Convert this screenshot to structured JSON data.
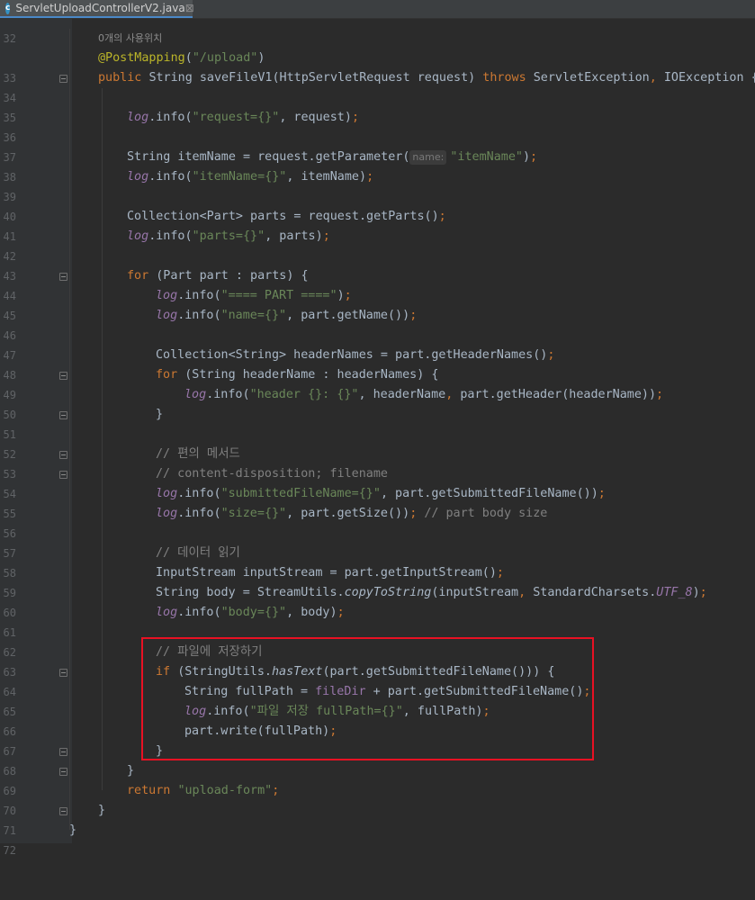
{
  "tab": {
    "icon": "c",
    "title": "ServletUploadControllerV2.java",
    "close": "⊠"
  },
  "usage_hint": "0개의 사용위치",
  "param_hint": "name:",
  "lines": {
    "n32": "32",
    "n33": "33",
    "n34": "34",
    "n35": "35",
    "n36": "36",
    "n37": "37",
    "n38": "38",
    "n39": "39",
    "n40": "40",
    "n41": "41",
    "n42": "42",
    "n43": "43",
    "n44": "44",
    "n45": "45",
    "n46": "46",
    "n47": "47",
    "n48": "48",
    "n49": "49",
    "n50": "50",
    "n51": "51",
    "n52": "52",
    "n53": "53",
    "n54": "54",
    "n55": "55",
    "n56": "56",
    "n57": "57",
    "n58": "58",
    "n59": "59",
    "n60": "60",
    "n61": "61",
    "n62": "62",
    "n63": "63",
    "n64": "64",
    "n65": "65",
    "n66": "66",
    "n67": "67",
    "n68": "68",
    "n69": "69",
    "n70": "70",
    "n71": "71",
    "n72": "72"
  },
  "code": {
    "l33": [
      "@PostMapping",
      "(",
      "\"/upload\"",
      ")"
    ],
    "l34": [
      "public ",
      "String saveFileV1(HttpServletRequest request) ",
      "throws ",
      "ServletException",
      ", ",
      "IOException {"
    ],
    "l36": [
      "log",
      ".info(",
      "\"request={}\"",
      ", request)",
      ";"
    ],
    "l38": [
      "String itemName = request.getParameter(",
      "\"itemName\"",
      ")",
      ";"
    ],
    "l39": [
      "log",
      ".info(",
      "\"itemName={}\"",
      ", itemName)",
      ";"
    ],
    "l41": [
      "Collection<Part> parts = request.getParts()",
      ";"
    ],
    "l42": [
      "log",
      ".info(",
      "\"parts={}\"",
      ", parts)",
      ";"
    ],
    "l44": [
      "for ",
      "(Part part : parts) {"
    ],
    "l45": [
      "log",
      ".info(",
      "\"==== PART ====\"",
      ")",
      ";"
    ],
    "l46": [
      "log",
      ".info(",
      "\"name={}\"",
      ", part.getName())",
      ";"
    ],
    "l48": [
      "Collection<String> headerNames = part.getHeaderNames()",
      ";"
    ],
    "l49": [
      "for ",
      "(String headerName : headerNames) {"
    ],
    "l50": [
      "log",
      ".info(",
      "\"header {}: {}\"",
      ", headerName",
      ", ",
      "part.getHeader(headerName))",
      ";"
    ],
    "l51": [
      "}"
    ],
    "l53": [
      "// 편의 메서드"
    ],
    "l54": [
      "// content-disposition; filename"
    ],
    "l55": [
      "log",
      ".info(",
      "\"submittedFileName={}\"",
      ", part.getSubmittedFileName())",
      ";"
    ],
    "l56": [
      "log",
      ".info(",
      "\"size={}\"",
      ", part.getSize())",
      "; ",
      "// part body size"
    ],
    "l58": [
      "// 데이터 읽기"
    ],
    "l59": [
      "InputStream inputStream = part.getInputStream()",
      ";"
    ],
    "l60": [
      "String body = StreamUtils.",
      "copyToString",
      "(inputStream",
      ", ",
      "StandardCharsets.",
      "UTF_8",
      ")",
      ";"
    ],
    "l61": [
      "log",
      ".info(",
      "\"body={}\"",
      ", body)",
      ";"
    ],
    "l63": [
      "// 파일에 저장하기"
    ],
    "l64": [
      "if ",
      "(StringUtils.",
      "hasText",
      "(part.getSubmittedFileName())) {"
    ],
    "l65": [
      "String fullPath = ",
      "fileDir ",
      "+ part.getSubmittedFileName()",
      ";"
    ],
    "l66": [
      "log",
      ".info(",
      "\"파일 저장 fullPath={}\"",
      ", fullPath)",
      ";"
    ],
    "l67": [
      "part.write(fullPath)",
      ";"
    ],
    "l68": [
      "}"
    ],
    "l69": [
      "}"
    ],
    "l70": [
      "return ",
      "\"upload-form\"",
      ";"
    ],
    "l71": [
      "}"
    ],
    "l72": [
      "}"
    ]
  },
  "colors": {
    "keyword": "#cc7832",
    "string": "#6a8759",
    "comment": "#808080",
    "annotation": "#bbb529",
    "field": "#9876aa",
    "default": "#a9b7c6",
    "highlight_box": "#e81123"
  }
}
